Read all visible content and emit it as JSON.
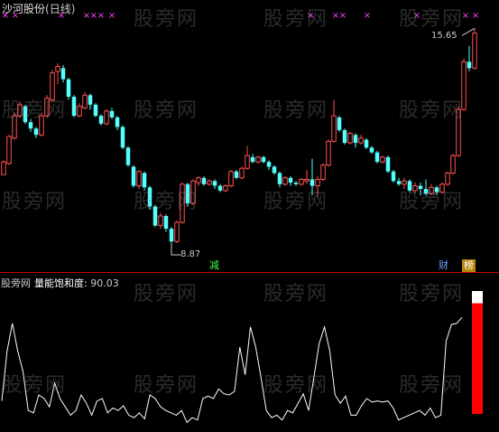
{
  "main_panel": {
    "title_name": "沙河股份",
    "title_period": "(日线)",
    "max_label": "15.65",
    "min_label": "8.87"
  },
  "indicator_panel": {
    "prefix": "股旁网",
    "name": "量能饱和度:",
    "value": "90.03"
  },
  "markers": {
    "jian": "减",
    "cai": "财",
    "bang": "榜"
  },
  "watermark": "股旁网",
  "colors": {
    "up": "#ff5050",
    "down": "#54ffff",
    "separator": "#c00000",
    "xmark": "#ff40ff",
    "line": "#ffffff",
    "bar": "#ff0000"
  },
  "chart_data": [
    {
      "type": "candlestick",
      "title": "沙河股份(日线)",
      "ylim": [
        8.5,
        16.2
      ],
      "candles": [
        [
          11.05,
          11.45,
          11.05,
          11.5
        ],
        [
          11.4,
          12.25,
          11.35,
          12.3
        ],
        [
          12.2,
          12.9,
          12.15,
          13.0
        ],
        [
          12.9,
          13.25,
          12.85,
          13.35
        ],
        [
          13.2,
          12.7,
          12.65,
          13.25
        ],
        [
          12.7,
          12.5,
          12.4,
          12.8
        ],
        [
          12.5,
          12.3,
          12.2,
          12.55
        ],
        [
          12.3,
          12.9,
          12.25,
          13.0
        ],
        [
          12.9,
          13.45,
          12.85,
          13.55
        ],
        [
          13.4,
          14.25,
          13.35,
          14.35
        ],
        [
          14.3,
          14.45,
          13.9,
          14.55
        ],
        [
          14.4,
          14.05,
          13.95,
          14.5
        ],
        [
          14.05,
          13.5,
          13.4,
          14.1
        ],
        [
          13.5,
          12.9,
          12.85,
          13.55
        ],
        [
          12.9,
          13.2,
          12.85,
          13.3
        ],
        [
          13.15,
          13.55,
          13.1,
          13.65
        ],
        [
          13.55,
          13.25,
          13.1,
          13.6
        ],
        [
          13.25,
          12.9,
          12.85,
          13.3
        ],
        [
          12.9,
          12.65,
          12.6,
          12.95
        ],
        [
          12.65,
          13.05,
          12.6,
          13.1
        ],
        [
          13.05,
          12.85,
          12.8,
          13.15
        ],
        [
          12.85,
          12.55,
          12.45,
          12.9
        ],
        [
          12.55,
          11.9,
          11.85,
          12.6
        ],
        [
          11.9,
          11.35,
          11.3,
          11.95
        ],
        [
          11.3,
          10.7,
          10.65,
          11.35
        ],
        [
          10.7,
          11.15,
          10.6,
          11.2
        ],
        [
          11.1,
          10.65,
          10.55,
          11.15
        ],
        [
          10.65,
          10.05,
          9.95,
          10.7
        ],
        [
          10.05,
          9.45,
          9.4,
          10.1
        ],
        [
          9.45,
          9.75,
          9.35,
          9.85
        ],
        [
          9.75,
          9.35,
          9.25,
          9.8
        ],
        [
          9.35,
          8.95,
          8.87,
          9.4
        ],
        [
          8.95,
          9.55,
          8.9,
          9.6
        ],
        [
          9.55,
          10.75,
          9.5,
          10.8
        ],
        [
          10.75,
          10.15,
          10.05,
          10.8
        ],
        [
          10.15,
          10.85,
          10.1,
          10.9
        ],
        [
          10.8,
          10.95,
          10.7,
          11.0
        ],
        [
          10.95,
          10.75,
          10.7,
          11.0
        ],
        [
          10.75,
          10.85,
          10.7,
          10.9
        ],
        [
          10.85,
          10.7,
          10.6,
          10.9
        ],
        [
          10.7,
          10.55,
          10.5,
          10.75
        ],
        [
          10.55,
          10.7,
          10.5,
          10.75
        ],
        [
          10.7,
          11.15,
          10.65,
          11.2
        ],
        [
          11.15,
          10.95,
          10.9,
          11.2
        ],
        [
          10.95,
          11.25,
          10.9,
          11.3
        ],
        [
          11.25,
          11.65,
          11.2,
          11.95
        ],
        [
          11.6,
          11.45,
          11.4,
          11.7
        ],
        [
          11.45,
          11.6,
          11.4,
          11.65
        ],
        [
          11.6,
          11.45,
          11.4,
          11.65
        ],
        [
          11.45,
          11.3,
          11.2,
          11.5
        ],
        [
          11.3,
          11.1,
          11.05,
          11.35
        ],
        [
          11.1,
          10.75,
          10.65,
          11.15
        ],
        [
          10.75,
          10.95,
          10.7,
          11.0
        ],
        [
          10.95,
          10.8,
          10.7,
          11.0
        ],
        [
          10.8,
          10.75,
          10.7,
          10.85
        ],
        [
          10.75,
          10.9,
          10.7,
          10.95
        ],
        [
          10.85,
          10.9,
          10.75,
          11.2
        ],
        [
          10.9,
          10.7,
          10.4,
          11.55
        ],
        [
          10.7,
          10.9,
          10.35,
          11.0
        ],
        [
          10.9,
          11.35,
          10.85,
          11.4
        ],
        [
          11.35,
          12.1,
          11.3,
          12.15
        ],
        [
          12.1,
          12.9,
          12.05,
          13.4
        ],
        [
          12.85,
          12.45,
          12.4,
          12.9
        ],
        [
          12.45,
          12.05,
          12.0,
          12.5
        ],
        [
          12.05,
          12.35,
          12.0,
          12.4
        ],
        [
          12.3,
          12.05,
          11.9,
          12.35
        ],
        [
          12.05,
          12.2,
          12.0,
          12.3
        ],
        [
          12.15,
          11.9,
          11.85,
          12.2
        ],
        [
          11.9,
          11.75,
          11.7,
          11.95
        ],
        [
          11.75,
          11.45,
          11.4,
          11.8
        ],
        [
          11.45,
          11.6,
          11.4,
          11.65
        ],
        [
          11.6,
          11.15,
          11.1,
          11.65
        ],
        [
          11.15,
          10.85,
          10.8,
          11.2
        ],
        [
          10.85,
          10.75,
          10.7,
          10.95
        ],
        [
          10.75,
          10.85,
          10.6,
          10.95
        ],
        [
          10.85,
          10.55,
          10.5,
          10.9
        ],
        [
          10.55,
          10.7,
          10.45,
          10.8
        ],
        [
          10.7,
          10.6,
          10.4,
          10.8
        ],
        [
          10.6,
          10.45,
          10.4,
          10.9
        ],
        [
          10.45,
          10.65,
          10.4,
          10.75
        ],
        [
          10.65,
          10.5,
          10.4,
          10.7
        ],
        [
          10.5,
          10.75,
          10.45,
          10.8
        ],
        [
          10.75,
          11.1,
          10.7,
          11.15
        ],
        [
          11.1,
          11.65,
          11.05,
          11.7
        ],
        [
          11.65,
          13.1,
          11.6,
          13.2
        ],
        [
          13.1,
          14.6,
          13.05,
          14.7
        ],
        [
          14.6,
          14.4,
          14.3,
          15.1
        ],
        [
          14.4,
          15.5,
          14.35,
          15.65
        ]
      ],
      "annotations": [
        {
          "label": "15.65",
          "type": "max"
        },
        {
          "label": "8.87",
          "type": "min"
        }
      ]
    },
    {
      "type": "line",
      "title": "量能饱和度",
      "series": [
        {
          "values": [
            20,
            62,
            85,
            62,
            45,
            12,
            10,
            25,
            22,
            15,
            35,
            22,
            15,
            8,
            12,
            25,
            18,
            8,
            20,
            22,
            10,
            14,
            12,
            16,
            8,
            6,
            10,
            5,
            25,
            22,
            15,
            12,
            10,
            8,
            12,
            2,
            6,
            4,
            22,
            24,
            22,
            30,
            26,
            25,
            28,
            65,
            42,
            82,
            65,
            40,
            12,
            6,
            8,
            4,
            12,
            10,
            18,
            26,
            12,
            40,
            68,
            82,
            62,
            25,
            18,
            24,
            8,
            8,
            16,
            22,
            19,
            20,
            19,
            20,
            14,
            4,
            6,
            8,
            10,
            12,
            8,
            14,
            6,
            8,
            70,
            84,
            85,
            90.03
          ]
        }
      ],
      "ylim": [
        0,
        100
      ],
      "latest_value": 90.03,
      "bar_value": 90.03
    }
  ]
}
